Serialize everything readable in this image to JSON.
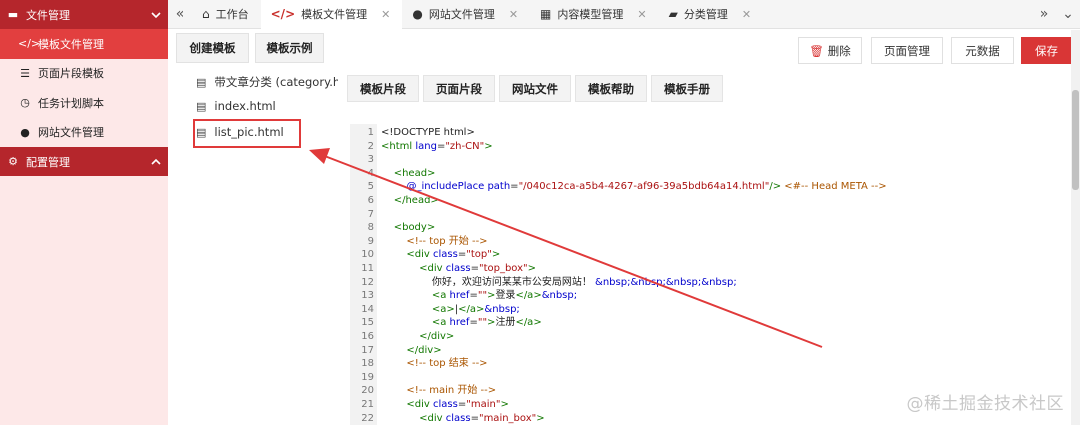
{
  "sidebar": {
    "group1_label": "文件管理",
    "group1_icon": "folder-icon",
    "items": [
      {
        "label": "模板文件管理",
        "icon": "code-icon",
        "active": true
      },
      {
        "label": "页面片段模板",
        "icon": "list-icon",
        "active": false
      },
      {
        "label": "任务计划脚本",
        "icon": "clock-icon",
        "active": false
      },
      {
        "label": "网站文件管理",
        "icon": "globe-icon",
        "active": false
      }
    ],
    "group2_label": "配置管理",
    "group2_icon": "gear-icon"
  },
  "tabs": [
    {
      "label": "工作台",
      "icon": "home-icon",
      "closable": false
    },
    {
      "label": "模板文件管理",
      "icon": "code-icon",
      "closable": true,
      "active": true
    },
    {
      "label": "网站文件管理",
      "icon": "globe-icon",
      "closable": true
    },
    {
      "label": "内容模型管理",
      "icon": "grid-icon",
      "closable": true
    },
    {
      "label": "分类管理",
      "icon": "folder-open-icon",
      "closable": true
    }
  ],
  "file_panel": {
    "create_button": "创建模板",
    "example_button": "模板示例",
    "files": [
      "带文章分类 (category.html)",
      "index.html",
      "list_pic.html"
    ]
  },
  "editor_toolbar": {
    "delete": "删除",
    "page_manage": "页面管理",
    "metadata": "元数据",
    "save": "保存",
    "tools": [
      "模板片段",
      "页面片段",
      "网站文件",
      "模板帮助",
      "模板手册"
    ]
  },
  "code_lines": [
    [
      {
        "t": "txt",
        "v": "<!DOCTYPE html>"
      }
    ],
    [
      {
        "t": "tag",
        "v": "<html "
      },
      {
        "t": "attr",
        "v": "lang"
      },
      {
        "t": "txt",
        "v": "="
      },
      {
        "t": "str",
        "v": "\"zh-CN\""
      },
      {
        "t": "tag",
        "v": ">"
      }
    ],
    [],
    [
      {
        "t": "tag",
        "v": "    <head>"
      }
    ],
    [
      {
        "t": "txt",
        "v": "        "
      },
      {
        "t": "attr",
        "v": "@_includePlace "
      },
      {
        "t": "attr",
        "v": "path"
      },
      {
        "t": "txt",
        "v": "="
      },
      {
        "t": "str",
        "v": "\"/040c12ca-a5b4-4267-af96-39a5bdb64a14.html\""
      },
      {
        "t": "tag",
        "v": "/>"
      },
      {
        "t": "txt",
        "v": " "
      },
      {
        "t": "cmt",
        "v": "<#-- Head META -->"
      }
    ],
    [
      {
        "t": "tag",
        "v": "    </head>"
      }
    ],
    [],
    [
      {
        "t": "tag",
        "v": "    <body>"
      }
    ],
    [
      {
        "t": "cmt",
        "v": "        <!-- top 开始 -->"
      }
    ],
    [
      {
        "t": "tag",
        "v": "        <div "
      },
      {
        "t": "attr",
        "v": "class"
      },
      {
        "t": "txt",
        "v": "="
      },
      {
        "t": "str",
        "v": "\"top\""
      },
      {
        "t": "tag",
        "v": ">"
      }
    ],
    [
      {
        "t": "tag",
        "v": "            <div "
      },
      {
        "t": "attr",
        "v": "class"
      },
      {
        "t": "txt",
        "v": "="
      },
      {
        "t": "str",
        "v": "\"top_box\""
      },
      {
        "t": "tag",
        "v": ">"
      }
    ],
    [
      {
        "t": "txt",
        "v": "                你好，欢迎访问某某市公安局网站！ "
      },
      {
        "t": "attr",
        "v": "&nbsp;&nbsp;&nbsp;&nbsp;"
      }
    ],
    [
      {
        "t": "tag",
        "v": "                <a "
      },
      {
        "t": "attr",
        "v": "href"
      },
      {
        "t": "txt",
        "v": "="
      },
      {
        "t": "str",
        "v": "\"\""
      },
      {
        "t": "tag",
        "v": ">"
      },
      {
        "t": "txt",
        "v": "登录"
      },
      {
        "t": "tag",
        "v": "</a>"
      },
      {
        "t": "attr",
        "v": "&nbsp;"
      }
    ],
    [
      {
        "t": "tag",
        "v": "                <a>"
      },
      {
        "t": "txt",
        "v": "|"
      },
      {
        "t": "tag",
        "v": "</a>"
      },
      {
        "t": "attr",
        "v": "&nbsp;"
      }
    ],
    [
      {
        "t": "tag",
        "v": "                <a "
      },
      {
        "t": "attr",
        "v": "href"
      },
      {
        "t": "txt",
        "v": "="
      },
      {
        "t": "str",
        "v": "\"\""
      },
      {
        "t": "tag",
        "v": ">"
      },
      {
        "t": "txt",
        "v": "注册"
      },
      {
        "t": "tag",
        "v": "</a>"
      }
    ],
    [
      {
        "t": "tag",
        "v": "            </div>"
      }
    ],
    [
      {
        "t": "tag",
        "v": "        </div>"
      }
    ],
    [
      {
        "t": "cmt",
        "v": "        <!-- top 结束 -->"
      }
    ],
    [],
    [
      {
        "t": "cmt",
        "v": "        <!-- main 开始 -->"
      }
    ],
    [
      {
        "t": "tag",
        "v": "        <div "
      },
      {
        "t": "attr",
        "v": "class"
      },
      {
        "t": "txt",
        "v": "="
      },
      {
        "t": "str",
        "v": "\"main\""
      },
      {
        "t": "tag",
        "v": ">"
      }
    ],
    [
      {
        "t": "tag",
        "v": "            <div "
      },
      {
        "t": "attr",
        "v": "class"
      },
      {
        "t": "txt",
        "v": "="
      },
      {
        "t": "str",
        "v": "\"main_box\""
      },
      {
        "t": "tag",
        "v": ">"
      }
    ]
  ],
  "watermark": "@稀土掘金技术社区",
  "colors": {
    "accent": "#b5262c",
    "active": "#e23f3f",
    "save": "#d93636",
    "sidebar_bg": "#fde8e8",
    "arrow": "#e03a3a"
  }
}
